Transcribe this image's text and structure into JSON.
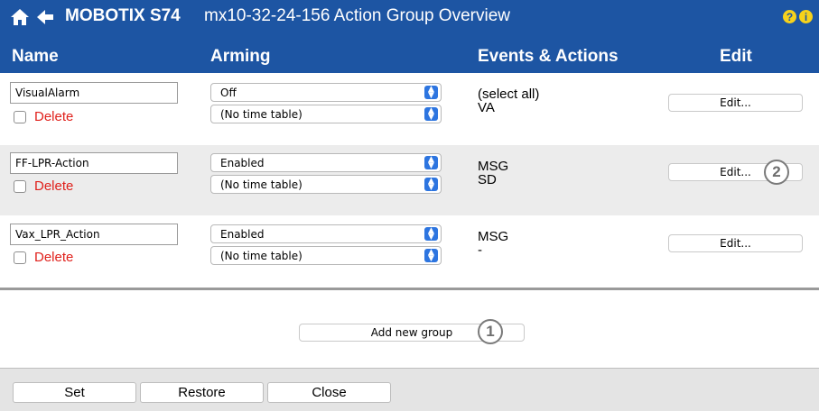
{
  "titlebar": {
    "brand": "MOBOTIX S74",
    "title": "mx10-32-24-156 Action Group Overview",
    "help_icon": "?",
    "info_icon": "i",
    "accent_color": "#1d55a3",
    "icon_color": "#f7d21b"
  },
  "columns": {
    "name": "Name",
    "arming": "Arming",
    "events_actions": "Events & Actions",
    "edit": "Edit"
  },
  "groups": [
    {
      "name": "VisualAlarm",
      "delete_label": "Delete",
      "arming": "Off",
      "time_table": "(No time table)",
      "events": [
        "(select all)",
        "VA"
      ],
      "edit_label": "Edit..."
    },
    {
      "name": "FF-LPR-Action",
      "delete_label": "Delete",
      "arming": "Enabled",
      "time_table": "(No time table)",
      "events": [
        "MSG",
        "SD"
      ],
      "edit_label": "Edit...",
      "callout": "2"
    },
    {
      "name": "Vax_LPR_Action",
      "delete_label": "Delete",
      "arming": "Enabled",
      "time_table": "(No time table)",
      "events": [
        "MSG",
        "-"
      ],
      "edit_label": "Edit..."
    }
  ],
  "add_group": {
    "label": "Add new group",
    "callout": "1"
  },
  "footer": {
    "set": "Set",
    "restore": "Restore",
    "close": "Close"
  }
}
